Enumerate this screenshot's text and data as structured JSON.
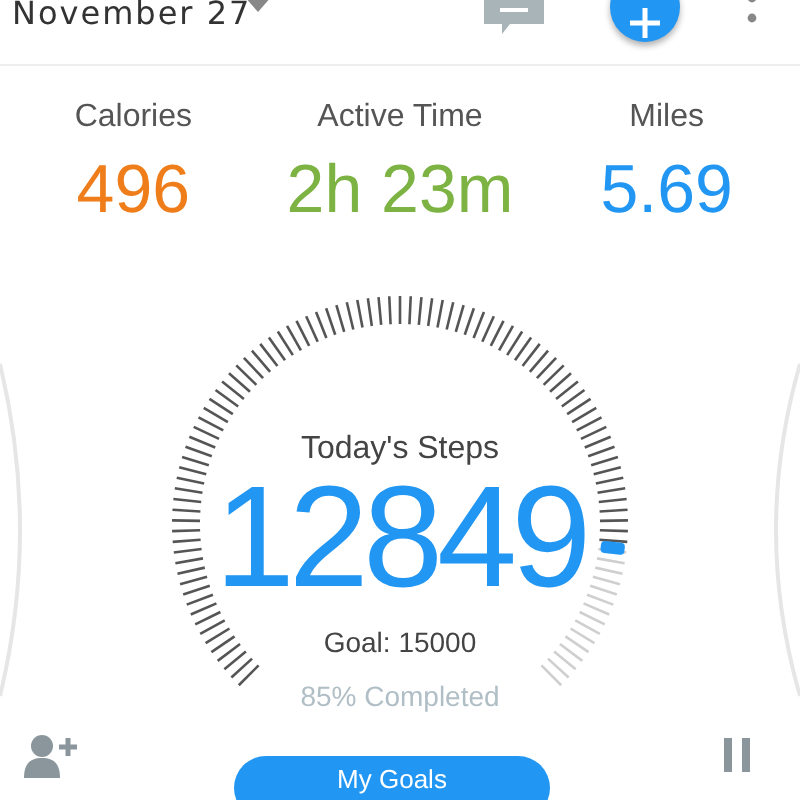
{
  "header": {
    "date": "November 27"
  },
  "stats": [
    {
      "label": "Calories",
      "value": "496",
      "color": "#ef7d1a"
    },
    {
      "label": "Active Time",
      "value": "2h 23m",
      "color": "#7cb342"
    },
    {
      "label": "Miles",
      "value": "5.69",
      "color": "#2196f3"
    }
  ],
  "steps": {
    "title": "Today's Steps",
    "count": "12849",
    "goal": "Goal: 15000",
    "completed": "85% Completed"
  },
  "goals_button": "My Goals"
}
